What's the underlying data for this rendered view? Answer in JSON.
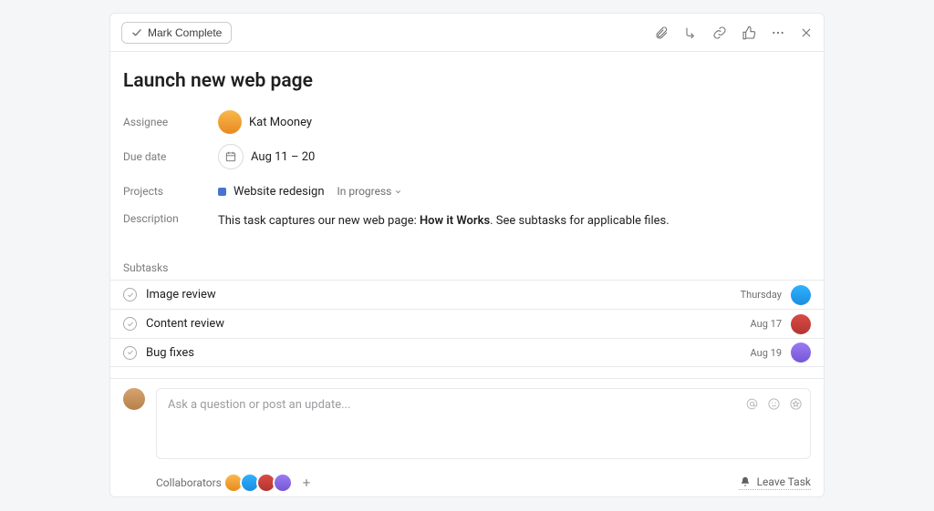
{
  "toolbar": {
    "mark_complete_label": "Mark Complete"
  },
  "task": {
    "title": "Launch new web page",
    "assignee_label": "Assignee",
    "assignee_name": "Kat Mooney",
    "due_date_label": "Due date",
    "due_date_value": "Aug 11 – 20",
    "projects_label": "Projects",
    "project_name": "Website redesign",
    "project_status": "In progress",
    "description_label": "Description",
    "description_prefix": "This task captures our new web page: ",
    "description_bold": "How it Works",
    "description_suffix": ". See subtasks for applicable files."
  },
  "subtasks": {
    "label": "Subtasks",
    "items": [
      {
        "name": "Image review",
        "date": "Thursday",
        "avatar_class": "av-blue"
      },
      {
        "name": "Content review",
        "date": "Aug 17",
        "avatar_class": "av-red"
      },
      {
        "name": "Bug fixes",
        "date": "Aug 19",
        "avatar_class": "av-purple"
      }
    ]
  },
  "composer": {
    "placeholder": "Ask a question or post an update..."
  },
  "footer": {
    "collaborators_label": "Collaborators",
    "leave_task_label": "Leave Task"
  }
}
